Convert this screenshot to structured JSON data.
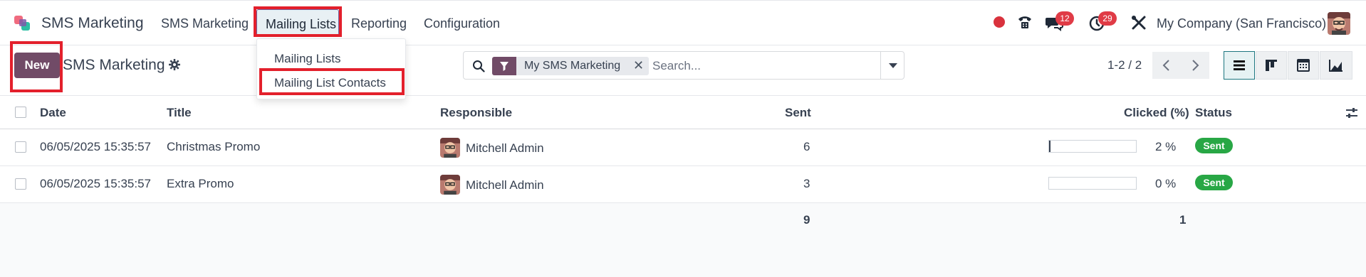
{
  "navbar": {
    "app_name": "SMS Marketing",
    "menu": [
      "SMS Marketing",
      "Mailing Lists",
      "Reporting",
      "Configuration"
    ],
    "messages_count": "12",
    "activities_count": "29",
    "company": "My Company (San Francisco)"
  },
  "dropdown": {
    "items": [
      "Mailing Lists",
      "Mailing List Contacts"
    ]
  },
  "control": {
    "new_label": "New",
    "title": "SMS Marketing",
    "facet": "My SMS Marketing",
    "search_placeholder": "Search...",
    "pager": "1-2 / 2"
  },
  "table": {
    "headers": {
      "date": "Date",
      "title": "Title",
      "responsible": "Responsible",
      "sent": "Sent",
      "clicked": "Clicked (%)",
      "status": "Status"
    },
    "rows": [
      {
        "date": "06/05/2025 15:35:57",
        "title": "Christmas Promo",
        "responsible": "Mitchell Admin",
        "sent": "6",
        "clicked_text": "2 %",
        "clicked_fraction": 0.02,
        "status": "Sent"
      },
      {
        "date": "06/05/2025 15:35:57",
        "title": "Extra Promo",
        "responsible": "Mitchell Admin",
        "sent": "3",
        "clicked_text": "0 %",
        "clicked_fraction": 0.0,
        "status": "Sent"
      }
    ],
    "totals": {
      "sent": "9",
      "clicked": "1"
    }
  },
  "colors": {
    "brand": "#714b67",
    "status_sent": "#28a745",
    "badge": "#e03b46",
    "highlight": "#e3202c"
  }
}
